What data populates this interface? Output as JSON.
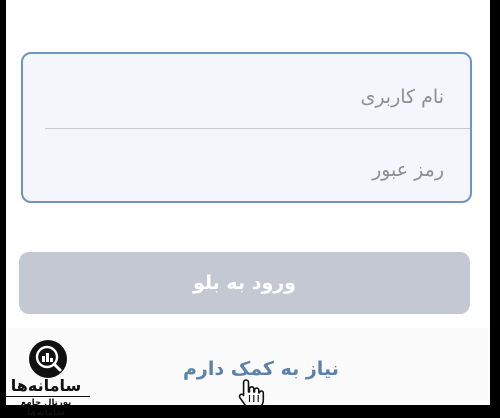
{
  "login_form": {
    "username_placeholder": "نام کاربری",
    "password_placeholder": "رمز عبور",
    "submit_label": "ورود به بلو"
  },
  "help": {
    "link_label": "نیاز به کمک دارم"
  },
  "watermark": {
    "title": "سامانه‌ها",
    "subtitle": "پورتال جامع سامانه‌ها"
  },
  "colors": {
    "card_border": "#6f93c4",
    "button_disabled": "#c3c8d2",
    "link": "#5b82ad"
  }
}
